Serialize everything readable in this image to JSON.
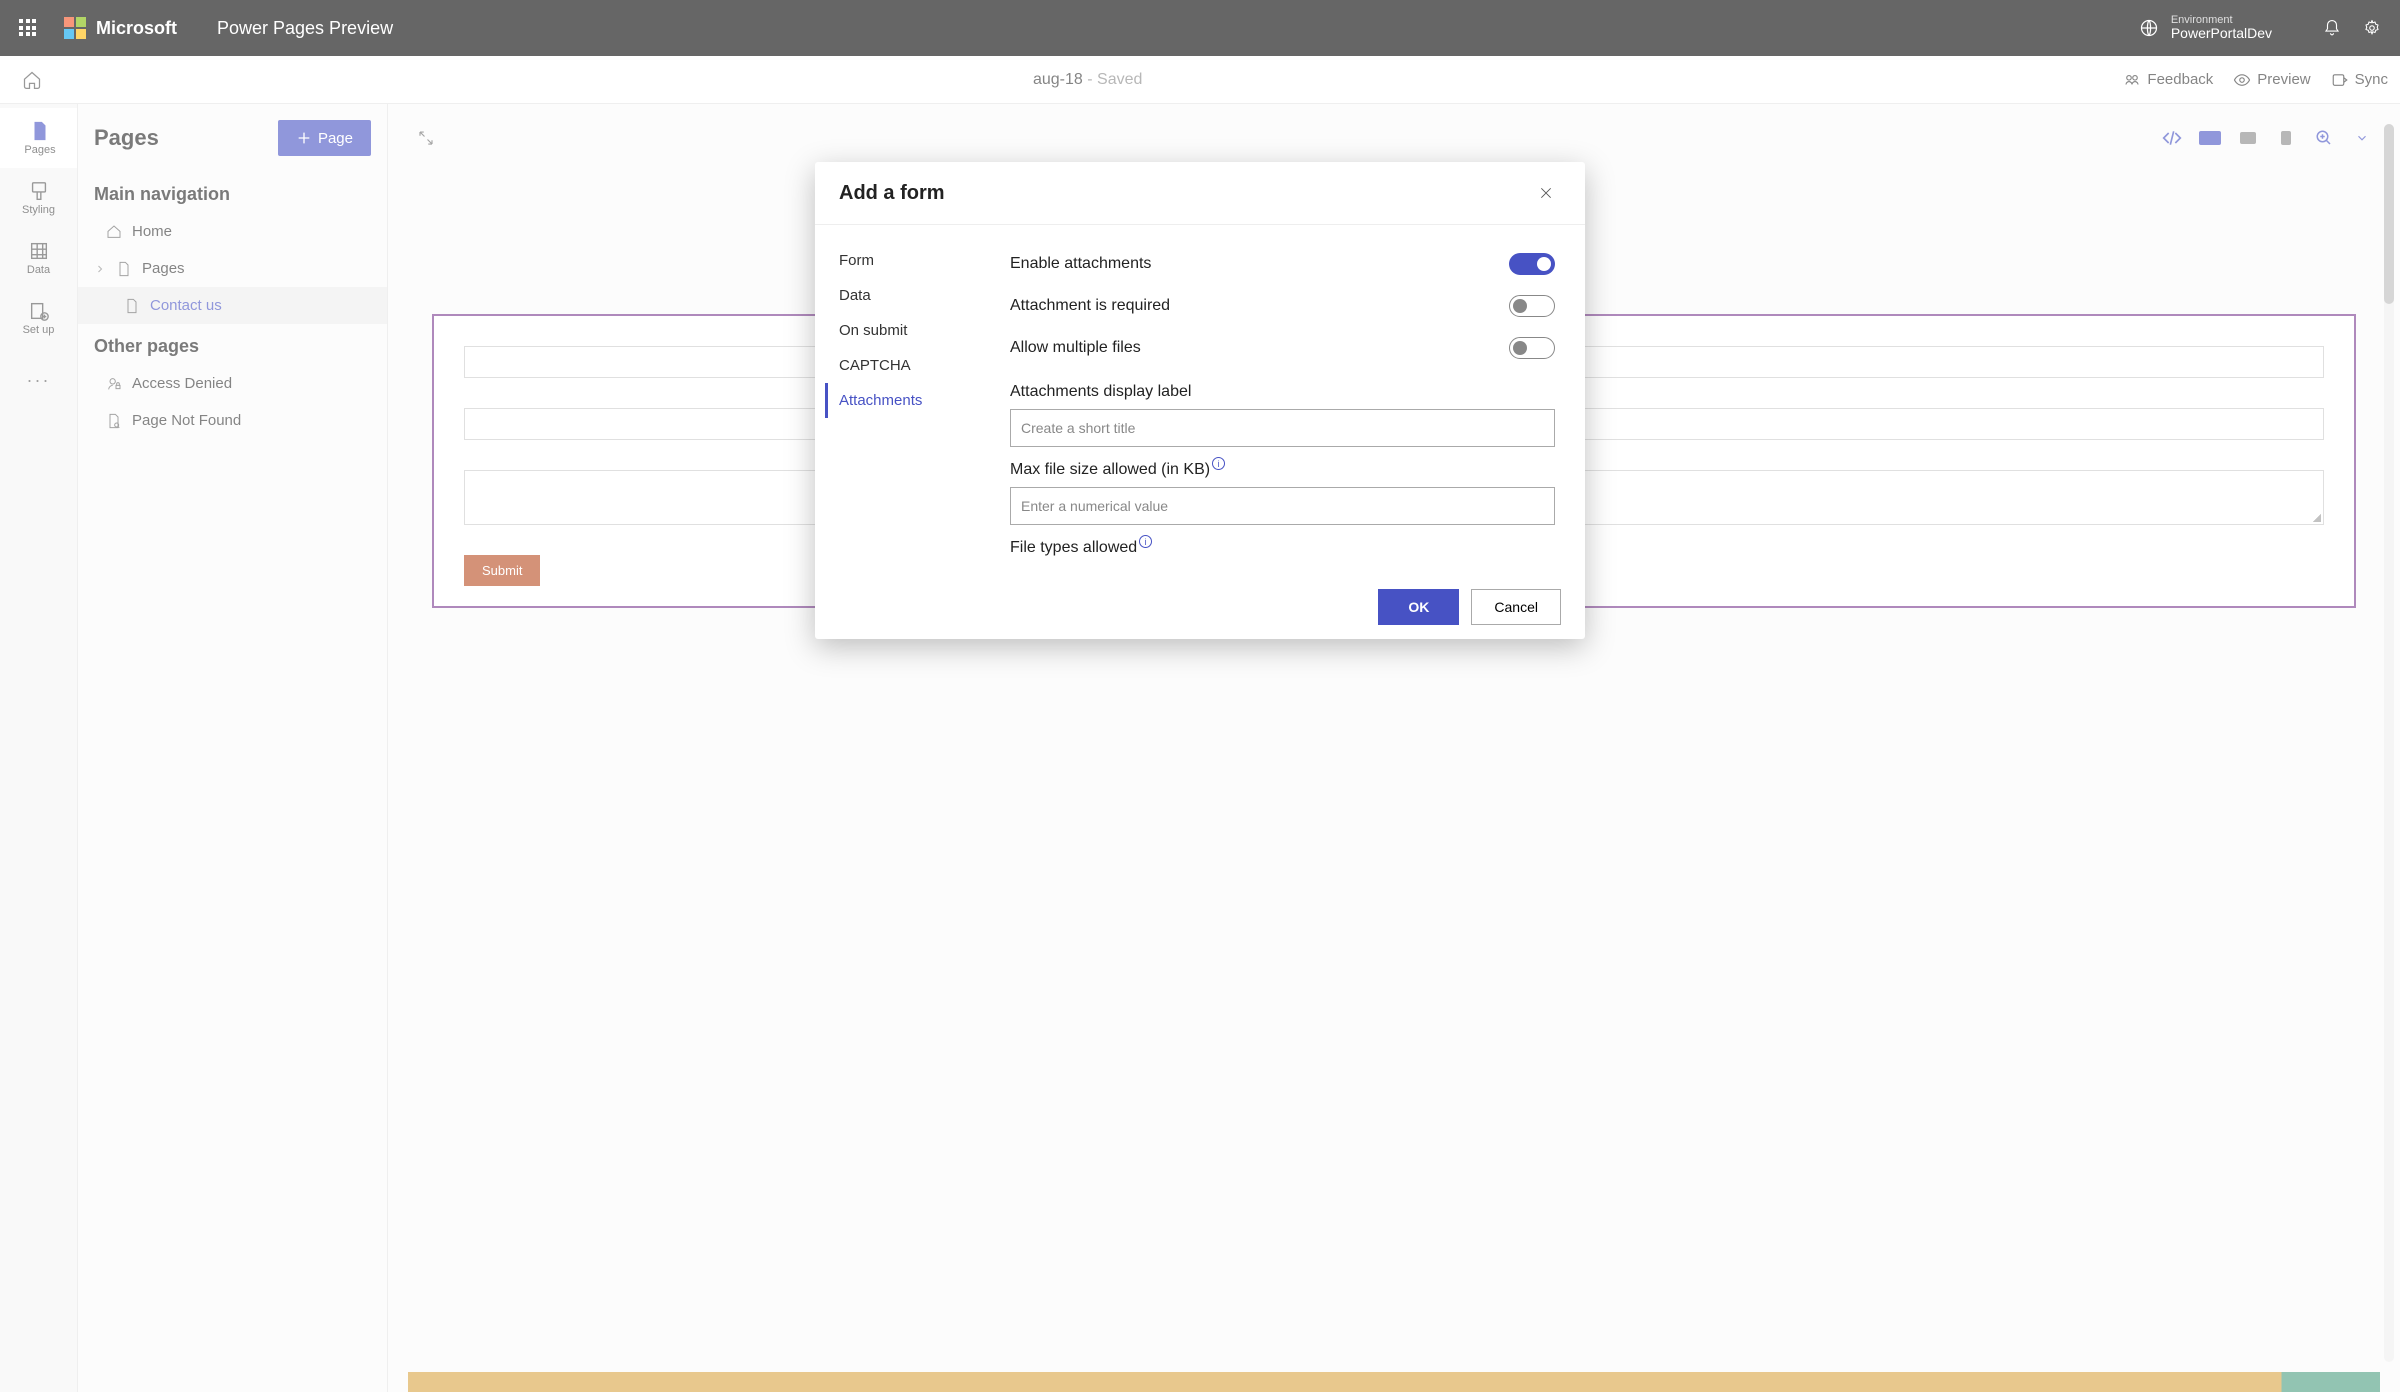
{
  "topbar": {
    "brand": "Microsoft",
    "app_name": "Power Pages Preview",
    "environment_label": "Environment",
    "environment_name": "PowerPortalDev"
  },
  "secondbar": {
    "doc_name": "aug-18",
    "saved_suffix": " - Saved",
    "feedback": "Feedback",
    "preview": "Preview",
    "sync": "Sync"
  },
  "leftrail": {
    "pages": "Pages",
    "styling": "Styling",
    "data": "Data",
    "setup": "Set up"
  },
  "leftpanel": {
    "title": "Pages",
    "add_page": "Page",
    "main_nav": "Main navigation",
    "home": "Home",
    "pages": "Pages",
    "contact_us": "Contact us",
    "other_pages": "Other pages",
    "access_denied": "Access Denied",
    "page_not_found": "Page Not Found"
  },
  "canvas": {
    "submit": "Submit"
  },
  "modal": {
    "title": "Add a form",
    "tabs": {
      "form": "Form",
      "data": "Data",
      "on_submit": "On submit",
      "captcha": "CAPTCHA",
      "attachments": "Attachments"
    },
    "options": {
      "enable_attachments": "Enable attachments",
      "attachment_required": "Attachment is required",
      "allow_multiple": "Allow multiple files",
      "display_label": "Attachments display label",
      "display_placeholder": "Create a short title",
      "max_size": "Max file size allowed (in KB)",
      "max_size_placeholder": "Enter a numerical value",
      "file_types": "File types allowed"
    },
    "buttons": {
      "ok": "OK",
      "cancel": "Cancel"
    }
  }
}
